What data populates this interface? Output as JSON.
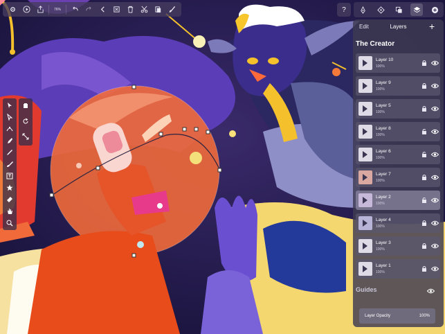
{
  "toolbar": {
    "zoom": "76%",
    "icons": [
      "gear-icon",
      "play-icon",
      "share-icon",
      "zoom-level",
      "undo-icon",
      "redo-icon",
      "chevron-left-icon",
      "delete-icon",
      "trash-icon",
      "scissors-icon",
      "paste-icon",
      "brush-icon"
    ]
  },
  "help": {
    "label": "?"
  },
  "tabs": {
    "icons": [
      "pen-icon",
      "transform-icon",
      "layers-square-icon",
      "stack-icon",
      "add-circle-icon"
    ]
  },
  "panel": {
    "edit_label": "Edit",
    "title": "Layers",
    "add_label": "+",
    "document_title": "The Creator",
    "layers": [
      {
        "name": "Layer 10",
        "opacity": "100%"
      },
      {
        "name": "Layer 9",
        "opacity": "100%"
      },
      {
        "name": "Layer 5",
        "opacity": "100%"
      },
      {
        "name": "Layer 8",
        "opacity": "100%"
      },
      {
        "name": "Layer 6",
        "opacity": "100%"
      },
      {
        "name": "Layer 7",
        "opacity": "100%"
      },
      {
        "name": "Layer 2",
        "opacity": "100%"
      },
      {
        "name": "Layer 4",
        "opacity": "100%"
      },
      {
        "name": "Layer 3",
        "opacity": "100%"
      },
      {
        "name": "Layer 1",
        "opacity": "100%"
      }
    ],
    "guides_label": "Guides",
    "opacity_label": "Layer Opacity",
    "opacity_value": "100%"
  },
  "tools": [
    "select-arrow-icon",
    "direct-select-icon",
    "node-tool-icon",
    "pen-tool-icon",
    "pencil-icon",
    "brush-icon",
    "text-icon",
    "star-icon",
    "eraser-icon",
    "hand-icon",
    "zoom-icon"
  ],
  "tools_secondary": [
    "transform-icon",
    "rotate-icon",
    "scale-icon"
  ]
}
